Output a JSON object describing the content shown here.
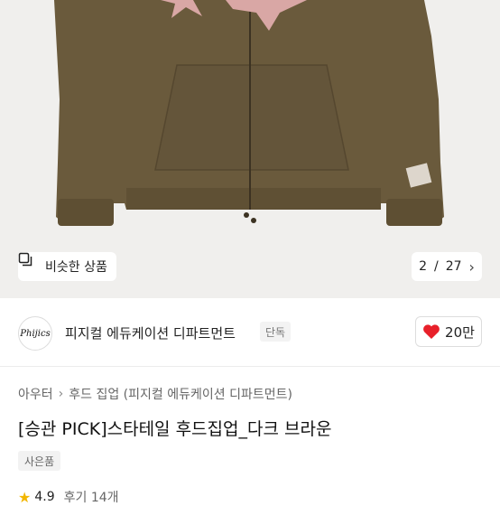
{
  "gallery": {
    "similar_label": "비슷한 상품",
    "similar_icon": "similar-items-icon",
    "current_page": "2",
    "page_separator": "/",
    "total_pages": "27",
    "next_icon": "chevron-right-icon"
  },
  "brand": {
    "logo_text": "Phijics",
    "name": "피지컬 에듀케이션 디파트먼트",
    "tag": "단독",
    "like_count": "20만",
    "like_icon": "heart-icon",
    "accent_color": "#e8202a"
  },
  "product": {
    "breadcrumb": [
      "아우터",
      "후드 집업 (피지컬 에듀케이션 디파트먼트)"
    ],
    "title": "[승관 PICK]스타테일 후드집업_다크 브라운",
    "gift_badge": "사은품",
    "rating": "4.9",
    "reviews": "후기 14개"
  }
}
